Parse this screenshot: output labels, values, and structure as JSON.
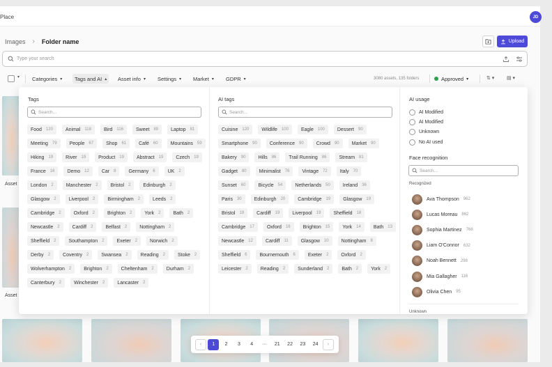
{
  "app": {
    "name": "Place",
    "avatar_initials": "JD"
  },
  "breadcrumb": {
    "root": "Images",
    "current": "Folder name"
  },
  "toolbar": {
    "upload_label": "Upload"
  },
  "search": {
    "placeholder": "Type your search"
  },
  "filters": {
    "items": [
      {
        "label": "Categories"
      },
      {
        "label": "Tags and AI"
      },
      {
        "label": "Asset info"
      },
      {
        "label": "Settings"
      },
      {
        "label": "Market"
      },
      {
        "label": "GDPR"
      }
    ],
    "count_text": "3080 assets, 135 folders",
    "approval": {
      "label": "Approved",
      "color": "#2e9e4f"
    }
  },
  "panel": {
    "tags": {
      "title": "Tags",
      "placeholder": "Search...",
      "chips": [
        {
          "label": "Food",
          "count": "120"
        },
        {
          "label": "Animal",
          "count": "118"
        },
        {
          "label": "Bird",
          "count": "116"
        },
        {
          "label": "Sweet",
          "count": "89"
        },
        {
          "label": "Laptop",
          "count": "81"
        },
        {
          "label": "Meeting",
          "count": "79"
        },
        {
          "label": "People",
          "count": "67"
        },
        {
          "label": "Shop",
          "count": "61"
        },
        {
          "label": "Café",
          "count": "60"
        },
        {
          "label": "Mountains",
          "count": "59"
        },
        {
          "label": "Hiking",
          "count": "19"
        },
        {
          "label": "River",
          "count": "19"
        },
        {
          "label": "Product",
          "count": "19"
        },
        {
          "label": "Abstract",
          "count": "19"
        },
        {
          "label": "Czech",
          "count": "19"
        },
        {
          "label": "France",
          "count": "16"
        },
        {
          "label": "Demo",
          "count": "12"
        },
        {
          "label": "Car",
          "count": "8"
        },
        {
          "label": "Germany",
          "count": "6"
        },
        {
          "label": "UK",
          "count": "2"
        },
        {
          "label": "London",
          "count": "2"
        },
        {
          "label": "Manchester",
          "count": "2"
        },
        {
          "label": "Bristol",
          "count": "2"
        },
        {
          "label": "Edinburgh",
          "count": "2"
        },
        {
          "label": "Glasgow",
          "count": "2"
        },
        {
          "label": "Liverpool",
          "count": "2"
        },
        {
          "label": "Birmingham",
          "count": "2"
        },
        {
          "label": "Leeds",
          "count": "2"
        },
        {
          "label": "Cambridge",
          "count": "2"
        },
        {
          "label": "Oxford",
          "count": "2"
        },
        {
          "label": "Brighton",
          "count": "2"
        },
        {
          "label": "York",
          "count": "2"
        },
        {
          "label": "Bath",
          "count": "2"
        },
        {
          "label": "Newcastle",
          "count": "2"
        },
        {
          "label": "Cardiff",
          "count": "2"
        },
        {
          "label": "Belfast",
          "count": "2"
        },
        {
          "label": "Nottingham",
          "count": "2"
        },
        {
          "label": "Sheffield",
          "count": "2"
        },
        {
          "label": "Southampton",
          "count": "2"
        },
        {
          "label": "Exeter",
          "count": "2"
        },
        {
          "label": "Norwich",
          "count": "2"
        },
        {
          "label": "Derby",
          "count": "2"
        },
        {
          "label": "Coventry",
          "count": "2"
        },
        {
          "label": "Swansea",
          "count": "2"
        },
        {
          "label": "Reading",
          "count": "2"
        },
        {
          "label": "Stoke",
          "count": "2"
        },
        {
          "label": "Wolverhampton",
          "count": "2"
        },
        {
          "label": "Brighton",
          "count": "2"
        },
        {
          "label": "Cheltenham",
          "count": "2"
        },
        {
          "label": "Durham",
          "count": "2"
        },
        {
          "label": "Canterbury",
          "count": "2"
        },
        {
          "label": "Winchester",
          "count": "2"
        },
        {
          "label": "Lancaster",
          "count": "2"
        }
      ]
    },
    "ai_tags": {
      "title": "AI tags",
      "placeholder": "Search...",
      "chips": [
        {
          "label": "Cuisine",
          "count": "120"
        },
        {
          "label": "Wildlife",
          "count": "100"
        },
        {
          "label": "Eagle",
          "count": "100"
        },
        {
          "label": "Dessert",
          "count": "90"
        },
        {
          "label": "Smartphone",
          "count": "90"
        },
        {
          "label": "Conference",
          "count": "90"
        },
        {
          "label": "Crowd",
          "count": "90"
        },
        {
          "label": "Market",
          "count": "90"
        },
        {
          "label": "Bakery",
          "count": "90"
        },
        {
          "label": "Hills",
          "count": "86"
        },
        {
          "label": "Trail Running",
          "count": "86"
        },
        {
          "label": "Stream",
          "count": "81"
        },
        {
          "label": "Gadget",
          "count": "80"
        },
        {
          "label": "Minimalist",
          "count": "76"
        },
        {
          "label": "Vintage",
          "count": "72"
        },
        {
          "label": "Italy",
          "count": "70"
        },
        {
          "label": "Sunset",
          "count": "60"
        },
        {
          "label": "Bicycle",
          "count": "54"
        },
        {
          "label": "Netherlands",
          "count": "50"
        },
        {
          "label": "Ireland",
          "count": "36"
        },
        {
          "label": "Paris",
          "count": "30"
        },
        {
          "label": "Edinburgh",
          "count": "20"
        },
        {
          "label": "Cambridge",
          "count": "19"
        },
        {
          "label": "Glasgow",
          "count": "19"
        },
        {
          "label": "Bristol",
          "count": "19"
        },
        {
          "label": "Cardiff",
          "count": "19"
        },
        {
          "label": "Liverpool",
          "count": "19"
        },
        {
          "label": "Sheffield",
          "count": "18"
        },
        {
          "label": "Cambridge",
          "count": "17"
        },
        {
          "label": "Oxford",
          "count": "16"
        },
        {
          "label": "Brighton",
          "count": "15"
        },
        {
          "label": "York",
          "count": "14"
        },
        {
          "label": "Bath",
          "count": "13"
        },
        {
          "label": "Newcastle",
          "count": "12"
        },
        {
          "label": "Cardiff",
          "count": "11"
        },
        {
          "label": "Glasgow",
          "count": "10"
        },
        {
          "label": "Nottingham",
          "count": "8"
        },
        {
          "label": "Sheffield",
          "count": "6"
        },
        {
          "label": "Bournemouth",
          "count": "6"
        },
        {
          "label": "Exeter",
          "count": "2"
        },
        {
          "label": "Oxford",
          "count": "2"
        },
        {
          "label": "Leicester",
          "count": "2"
        },
        {
          "label": "Reading",
          "count": "2"
        },
        {
          "label": "Sunderland",
          "count": "2"
        },
        {
          "label": "Bath",
          "count": "2"
        },
        {
          "label": "York",
          "count": "2"
        }
      ]
    },
    "ai_usage": {
      "title": "AI usage",
      "options": [
        "AI Modified",
        "AI Modified",
        "Unknown",
        "No AI used"
      ]
    },
    "face": {
      "title": "Face recognition",
      "placeholder": "Search...",
      "recognized_label": "Recognized",
      "unknown_label": "Unknown",
      "people": [
        {
          "name": "Ava Thompson",
          "count": "962"
        },
        {
          "name": "Lucas Moreau",
          "count": "862"
        },
        {
          "name": "Sophia Martinez",
          "count": "768"
        },
        {
          "name": "Liam O'Connor",
          "count": "632"
        },
        {
          "name": "Noah Bennett",
          "count": "298"
        },
        {
          "name": "Mia Gallagher",
          "count": "116"
        },
        {
          "name": "Olivia Chen",
          "count": "95"
        }
      ]
    }
  },
  "assets": {
    "label": "Asset"
  },
  "pagination": {
    "pages": [
      "1",
      "2",
      "3",
      "4",
      "···",
      "21",
      "22",
      "23",
      "24"
    ],
    "current": "1"
  }
}
